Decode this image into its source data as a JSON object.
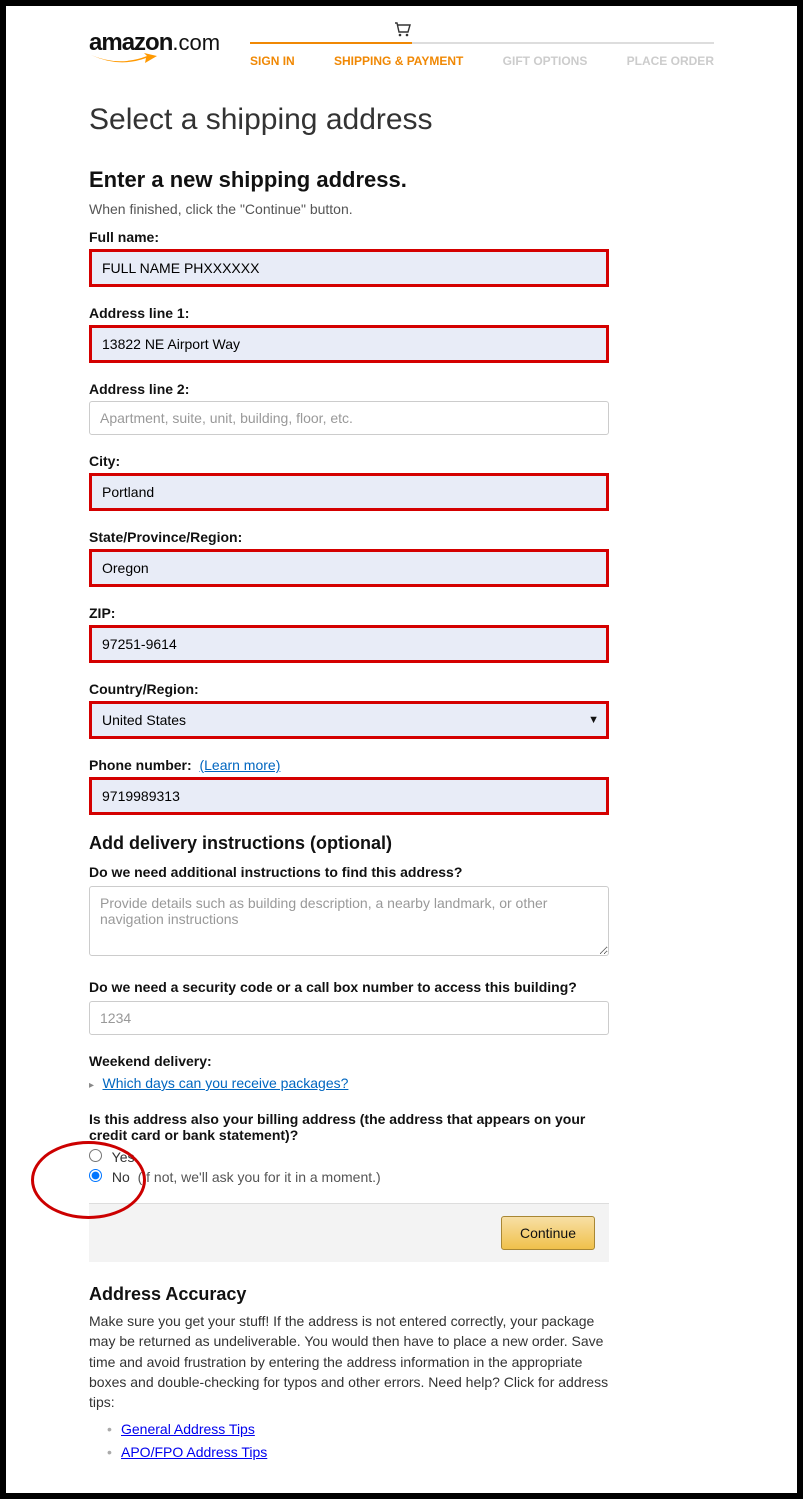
{
  "logo": {
    "name": "amazon",
    "suffix": ".com"
  },
  "progress": {
    "steps": [
      "SIGN IN",
      "SHIPPING & PAYMENT",
      "GIFT OPTIONS",
      "PLACE ORDER"
    ]
  },
  "page_title": "Select a shipping address",
  "form": {
    "heading": "Enter a new shipping address.",
    "subtext": "When finished, click the \"Continue\" button.",
    "fields": {
      "full_name": {
        "label": "Full name:",
        "value": "FULL NAME PHXXXXXX"
      },
      "address1": {
        "label": "Address line 1:",
        "value": "13822 NE Airport Way"
      },
      "address2": {
        "label": "Address line 2:",
        "placeholder": "Apartment, suite, unit, building, floor, etc."
      },
      "city": {
        "label": "City:",
        "value": "Portland"
      },
      "state": {
        "label": "State/Province/Region:",
        "value": "Oregon"
      },
      "zip": {
        "label": "ZIP:",
        "value": "97251-9614"
      },
      "country": {
        "label": "Country/Region:",
        "value": "United States"
      },
      "phone": {
        "label": "Phone number:",
        "learn_more": "(Learn more)",
        "value": "9719989313"
      }
    }
  },
  "delivery": {
    "heading": "Add delivery instructions (optional)",
    "q_instructions": "Do we need additional instructions to find this address?",
    "instructions_placeholder": "Provide details such as building description, a nearby landmark, or other navigation instructions",
    "q_security": "Do we need a security code or a call box number to access this building?",
    "security_placeholder": "1234",
    "weekend_label": "Weekend delivery:",
    "weekend_link": "Which days can you receive packages?"
  },
  "billing": {
    "question": "Is this address also your billing address (the address that appears on your credit card or bank statement)?",
    "yes": "Yes",
    "no": "No",
    "no_hint": "(If not, we'll ask you for it in a moment.)"
  },
  "continue_label": "Continue",
  "accuracy": {
    "heading": "Address Accuracy",
    "text": "Make sure you get your stuff! If the address is not entered correctly, your package may be returned as undeliverable. You would then have to place a new order. Save time and avoid frustration by entering the address information in the appropriate boxes and double-checking for typos and other errors. Need help? Click for address tips:",
    "links": [
      "General Address Tips",
      "APO/FPO Address Tips"
    ]
  }
}
